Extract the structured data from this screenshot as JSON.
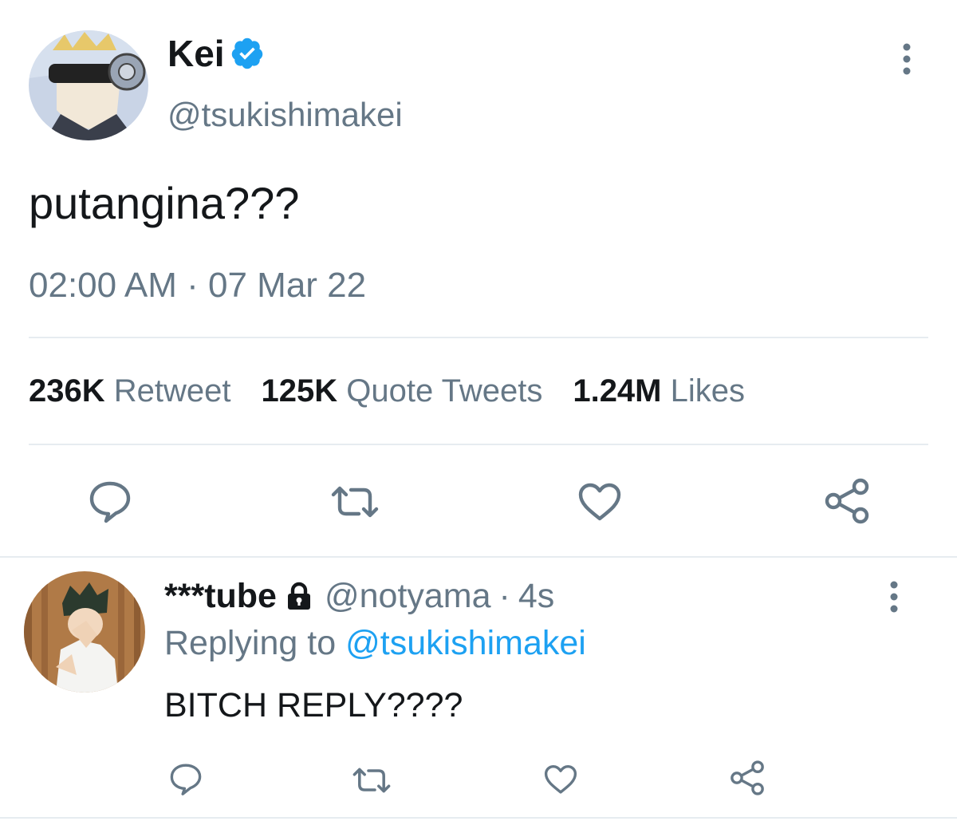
{
  "main_tweet": {
    "author": {
      "display_name": "Kei",
      "handle": "@tsukishimakei",
      "verified": true
    },
    "text": "putangina???",
    "timestamp": "02:00 AM · 07 Mar 22",
    "stats": {
      "retweets": {
        "count": "236K",
        "label": "Retweet"
      },
      "quotes": {
        "count": "125K",
        "label": "Quote Tweets"
      },
      "likes": {
        "count": "1.24M",
        "label": "Likes"
      }
    },
    "actions": [
      "reply-icon",
      "retweet-icon",
      "like-icon",
      "share-icon"
    ]
  },
  "reply_tweet": {
    "author": {
      "display_name": "***tube",
      "handle": "@notyama",
      "protected": true
    },
    "separator": "·",
    "age": "4s",
    "replying_prefix": "Replying to",
    "replying_handle": "@tsukishimakei",
    "text": "BITCH REPLY????",
    "actions": [
      "reply-icon",
      "retweet-icon",
      "like-icon",
      "share-icon"
    ]
  },
  "colors": {
    "accent": "#1da1f2",
    "muted": "#657786",
    "text": "#14171a",
    "divider": "#e6ecf0"
  }
}
